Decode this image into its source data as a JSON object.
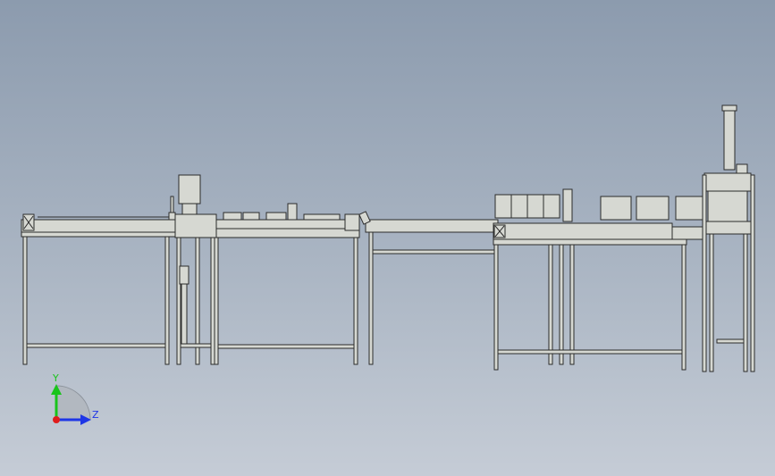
{
  "triad": {
    "y_label": "Y",
    "z_label": "Z",
    "y_color": "#19c41b",
    "z_color": "#1e36e6",
    "origin_color": "#e01c1c"
  },
  "colors": {
    "frame": "#d6d8d2",
    "outline": "#2b2b2b",
    "surface": "#c9cbc4"
  }
}
